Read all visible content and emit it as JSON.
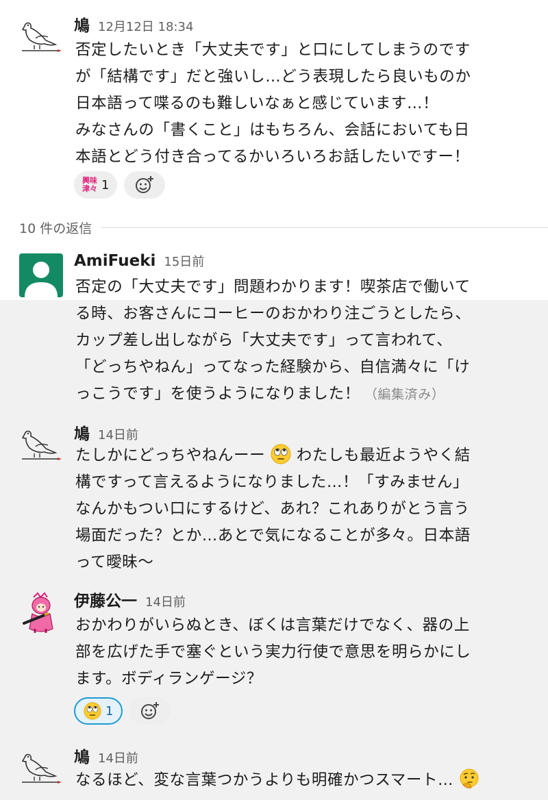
{
  "thread": {
    "reply_divider": "10 件の返信",
    "messages": [
      {
        "author": "鳩",
        "time": "12月12日 18:34",
        "avatar": "pigeon-icon",
        "text": "否定したいとき「大丈夫です」と口にしてしまうのです\nが「結構です」だと強いし…どう表現したら良いものか\n日本語って喋るのも難しいなぁと感じています…！\nみなさんの「書くこと」はもちろん、会話においても日\n本語とどう付き合ってるかいろいろお話したいですー！",
        "reactions": [
          {
            "emoji": "kyoumi-shinshin-badge",
            "badge_line1": "興味",
            "badge_line2": "津々",
            "count": "1"
          }
        ]
      },
      {
        "author": "AmiFueki",
        "time": "15日前",
        "avatar": "default-user-avatar",
        "text": "否定の「大丈夫です」問題わかります！喫茶店で働いて\nる時、お客さんにコーヒーのおかわり注ごうとしたら、\nカップ差し出しながら「大丈夫です」って言われて、\n「どっちやねん」ってなった経験から、自信満々に「け\nっこうです」を使うようになりました！",
        "edited_label": "（編集済み）"
      },
      {
        "author": "鳩",
        "time": "14日前",
        "avatar": "pigeon-icon",
        "text_part1": "たしかにどっちやねんーー",
        "text_part2": "わたしも最近ようやく結\n構ですって言えるようになりました…！「すみません」\nなんかもつい口にするけど、あれ？これありがとう言う\n場面だった？とか…あとで気になることが多々。日本語\nって曖昧〜",
        "inline_emoji": "eye-roll-emoji"
      },
      {
        "author": "伊藤公一",
        "time": "14日前",
        "avatar": "pink-character-avatar",
        "text": "おかわりがいらぬとき、ぼくは言葉だけでなく、器の上\n部を広げた手で塞ぐという実力行使で意思を明らかにし\nます。ボディランゲージ？",
        "reactions": [
          {
            "emoji": "eye-roll-emoji",
            "count": "1",
            "active": true
          }
        ]
      },
      {
        "author": "鳩",
        "time": "14日前",
        "avatar": "pigeon-icon",
        "text": "なるほど、変な言葉つかうよりも明確かつスマート…",
        "inline_emoji": "thinking-face-emoji"
      }
    ]
  },
  "colors": {
    "highlight_bg": "#f1f1f1",
    "active_reaction_border": "#1d9bd1",
    "avatar_green": "#138a63",
    "badge_pink": "#e0227a"
  }
}
